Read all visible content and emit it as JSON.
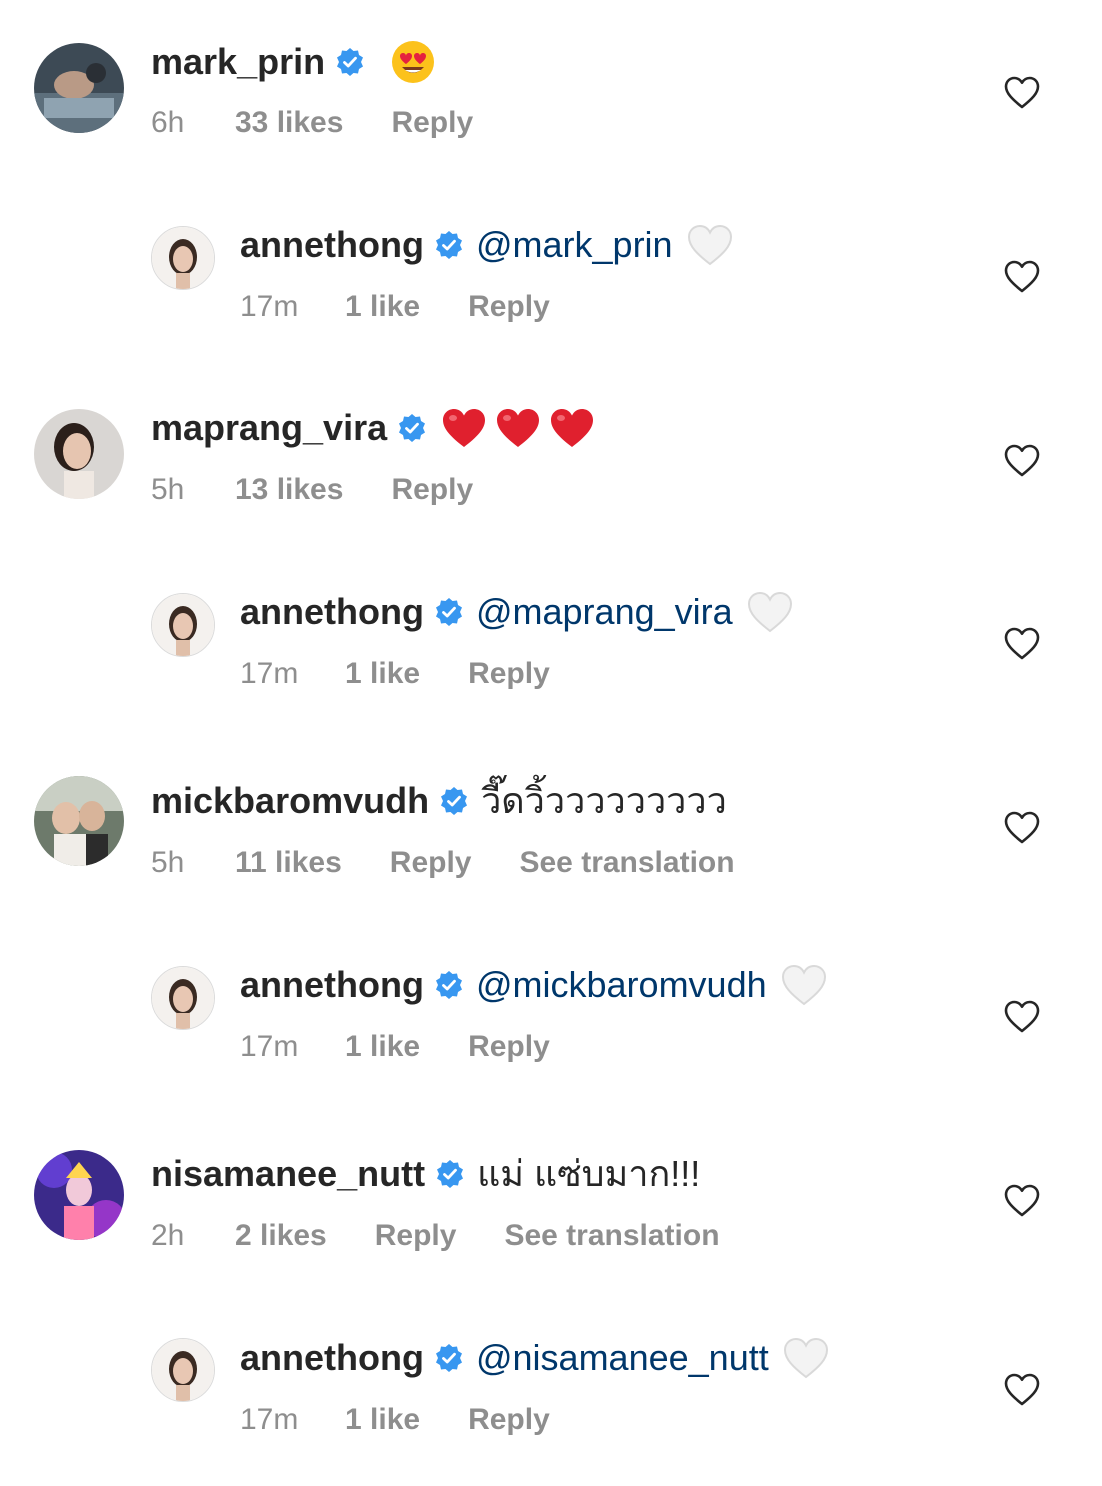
{
  "comments": [
    {
      "username": "mark_prin",
      "mention": "",
      "text": "",
      "emoji": [
        "heart-eyes"
      ],
      "time": "6h",
      "likes": "33 likes",
      "reply": "Reply",
      "translate": ""
    },
    {
      "username": "annethong",
      "mention": "@mark_prin",
      "text": "",
      "emoji": [
        "white-heart"
      ],
      "time": "17m",
      "likes": "1 like",
      "reply": "Reply",
      "translate": ""
    },
    {
      "username": "maprang_vira",
      "mention": "",
      "text": "",
      "emoji": [
        "red-heart",
        "red-heart",
        "red-heart"
      ],
      "time": "5h",
      "likes": "13 likes",
      "reply": "Reply",
      "translate": ""
    },
    {
      "username": "annethong",
      "mention": "@maprang_vira",
      "text": "",
      "emoji": [
        "white-heart"
      ],
      "time": "17m",
      "likes": "1 like",
      "reply": "Reply",
      "translate": ""
    },
    {
      "username": "mickbaromvudh",
      "mention": "",
      "text": "วี๊ดวิ้ววววววววว",
      "emoji": [],
      "time": "5h",
      "likes": "11 likes",
      "reply": "Reply",
      "translate": "See translation"
    },
    {
      "username": "annethong",
      "mention": "@mickbaromvudh",
      "text": "",
      "emoji": [
        "white-heart"
      ],
      "time": "17m",
      "likes": "1 like",
      "reply": "Reply",
      "translate": ""
    },
    {
      "username": "nisamanee_nutt",
      "mention": "",
      "text": "แม่ แซ่บมาก!!!",
      "emoji": [],
      "time": "2h",
      "likes": "2 likes",
      "reply": "Reply",
      "translate": "See translation"
    },
    {
      "username": "annethong",
      "mention": "@nisamanee_nutt",
      "text": "",
      "emoji": [
        "white-heart"
      ],
      "time": "17m",
      "likes": "1 like",
      "reply": "Reply",
      "translate": ""
    }
  ],
  "colors": {
    "username": "#262626",
    "meta": "#8e8e8e",
    "mention": "#00376b",
    "verified": "#3897f0"
  }
}
